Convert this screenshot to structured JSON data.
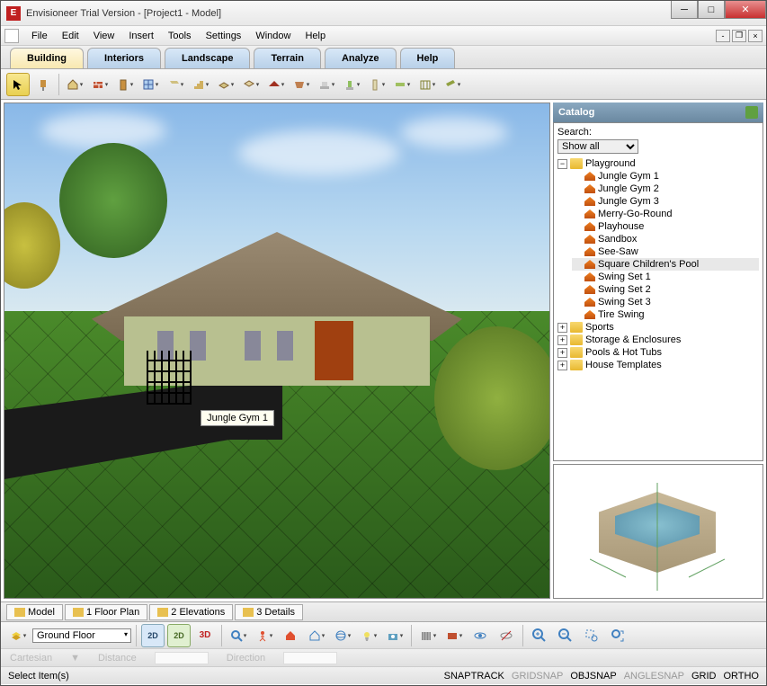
{
  "window": {
    "title": "Envisioneer Trial Version - [Project1 - Model]"
  },
  "menu": [
    "File",
    "Edit",
    "View",
    "Insert",
    "Tools",
    "Settings",
    "Window",
    "Help"
  ],
  "ribbon": [
    "Building",
    "Interiors",
    "Landscape",
    "Terrain",
    "Analyze",
    "Help"
  ],
  "ribbon_active": 0,
  "viewport": {
    "tooltip": "Jungle Gym 1"
  },
  "catalog": {
    "title": "Catalog",
    "search_label": "Search:",
    "filter": "Show all",
    "root": {
      "label": "Playground",
      "items": [
        "Jungle Gym 1",
        "Jungle Gym 2",
        "Jungle Gym 3",
        "Merry-Go-Round",
        "Playhouse",
        "Sandbox",
        "See-Saw",
        "Square Children's Pool",
        "Swing Set 1",
        "Swing Set 2",
        "Swing Set 3",
        "Tire Swing"
      ],
      "selected": "Square Children's Pool"
    },
    "siblings": [
      "Sports",
      "Storage & Enclosures",
      "Pools & Hot Tubs",
      "House Templates"
    ]
  },
  "viewtabs": [
    "Model",
    "1 Floor Plan",
    "2 Elevations",
    "3 Details"
  ],
  "floor_combo": "Ground Floor",
  "coord": {
    "sys": "Cartesian",
    "dist": "Distance",
    "dir": "Direction"
  },
  "status": {
    "left": "Select Item(s)",
    "toggles": [
      {
        "t": "SNAPTRACK",
        "on": true
      },
      {
        "t": "GRIDSNAP",
        "on": false
      },
      {
        "t": "OBJSNAP",
        "on": true
      },
      {
        "t": "ANGLESNAP",
        "on": false
      },
      {
        "t": "GRID",
        "on": true
      },
      {
        "t": "ORTHO",
        "on": true
      }
    ]
  }
}
